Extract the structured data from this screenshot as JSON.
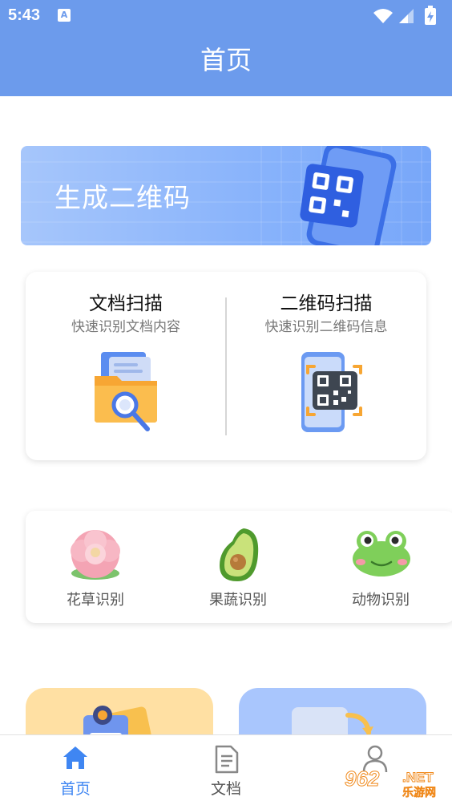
{
  "status_bar": {
    "time": "5:43",
    "notification_icon_letter": "A",
    "icons": [
      "wifi-icon",
      "signal-icon",
      "battery-charging-icon"
    ]
  },
  "header": {
    "title": "首页"
  },
  "banner": {
    "title": "生成二维码",
    "icon": "qr-phone-icon"
  },
  "scan_card": {
    "items": [
      {
        "title": "文档扫描",
        "subtitle": "快速识别文档内容",
        "icon": "folder-search-icon"
      },
      {
        "title": "二维码扫描",
        "subtitle": "快速识别二维码信息",
        "icon": "phone-qr-icon"
      }
    ]
  },
  "recognition_card": {
    "items": [
      {
        "label": "花草识别",
        "icon": "flower-icon"
      },
      {
        "label": "果蔬识别",
        "icon": "avocado-icon"
      },
      {
        "label": "动物识别",
        "icon": "frog-icon"
      }
    ]
  },
  "tab_bar": {
    "tabs": [
      {
        "label": "首页",
        "icon": "home-icon",
        "active": true
      },
      {
        "label": "文档",
        "icon": "document-icon",
        "active": false
      },
      {
        "label": "",
        "icon": "user-icon",
        "active": false
      }
    ],
    "active_color": "#3f86f2"
  },
  "watermark": {
    "number": "962",
    "domain": ".NET",
    "name": "乐游网"
  },
  "colors": {
    "header": "#6c9bec",
    "accent": "#3f86f2"
  }
}
